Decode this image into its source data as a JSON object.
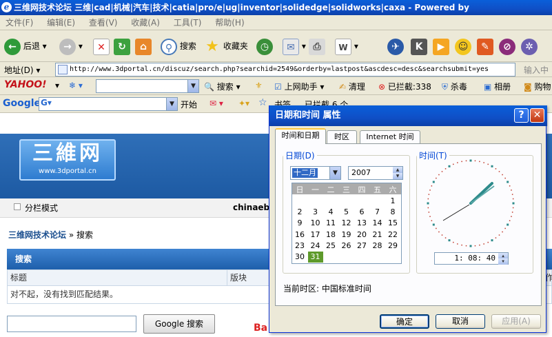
{
  "window": {
    "title": "三维网技术论坛 三维|cad|机械|汽车|技术|catia|pro/e|ug|inventor|solidedge|solidworks|caxa - Powered by"
  },
  "menu": [
    "文件(F)",
    "编辑(E)",
    "查看(V)",
    "收藏(A)",
    "工具(T)",
    "帮助(H)"
  ],
  "toolbar": {
    "back": "后退",
    "search": "搜索",
    "favorites": "收藏夹"
  },
  "address": {
    "label": "地址(D)",
    "url": "http://www.3dportal.cn/discuz/search.php?searchid=2549&orderby=lastpost&ascdesc=desc&searchsubmit=yes",
    "go": "输入中"
  },
  "yahoo": {
    "brand": "YAHOO!",
    "search": "搜索",
    "assistant": "上网助手",
    "clean": "清理",
    "blocked": "已拦截:",
    "blocked_count": "338",
    "antivirus": "杀毒",
    "album": "相册",
    "shop": "购物"
  },
  "google": {
    "brand": "Google",
    "start": "开始",
    "bookmarks": "书签",
    "blocked": "已拦截 6 个",
    "spell": "拼写检查",
    "translate": "翻译",
    "send": "发送至"
  },
  "site": {
    "logo_big": "三維网",
    "logo_small": "www.3dportal.cn",
    "view_mode": "分栏模式",
    "user": "chinaebw",
    "crumb_home": "三维网技术论坛",
    "crumb_sep": "»",
    "crumb_page": "搜索",
    "search_header": "搜索",
    "col_title": "标题",
    "col_forum": "版块",
    "col_extra": "作",
    "no_result": "对不起，没有找到匹配结果。",
    "google_btn": "Google 搜索",
    "baidu": "Ba"
  },
  "dialog": {
    "title": "日期和时间 属性",
    "help": "?",
    "tabs": [
      "时间和日期",
      "时区",
      "Internet 时间"
    ],
    "date_legend": "日期(D)",
    "time_legend": "时间(T)",
    "month": "十二月",
    "year": "2007",
    "weekdays": [
      "日",
      "一",
      "二",
      "三",
      "四",
      "五",
      "六"
    ],
    "days": [
      "1",
      "2",
      "3",
      "4",
      "5",
      "6",
      "7",
      "8",
      "9",
      "10",
      "11",
      "12",
      "13",
      "14",
      "15",
      "16",
      "17",
      "18",
      "19",
      "20",
      "21",
      "22",
      "23",
      "24",
      "25",
      "26",
      "27",
      "28",
      "29",
      "30",
      "31"
    ],
    "selected_day": "31",
    "time": "1: 08: 40",
    "timezone": "当前时区: 中国标准时间",
    "ok": "确定",
    "cancel": "取消",
    "apply": "应用(A)"
  },
  "colors": {
    "xp_blue": "#0a5fd9",
    "dialog_bg": "#ece9d8",
    "selection": "#5e9a2b"
  }
}
